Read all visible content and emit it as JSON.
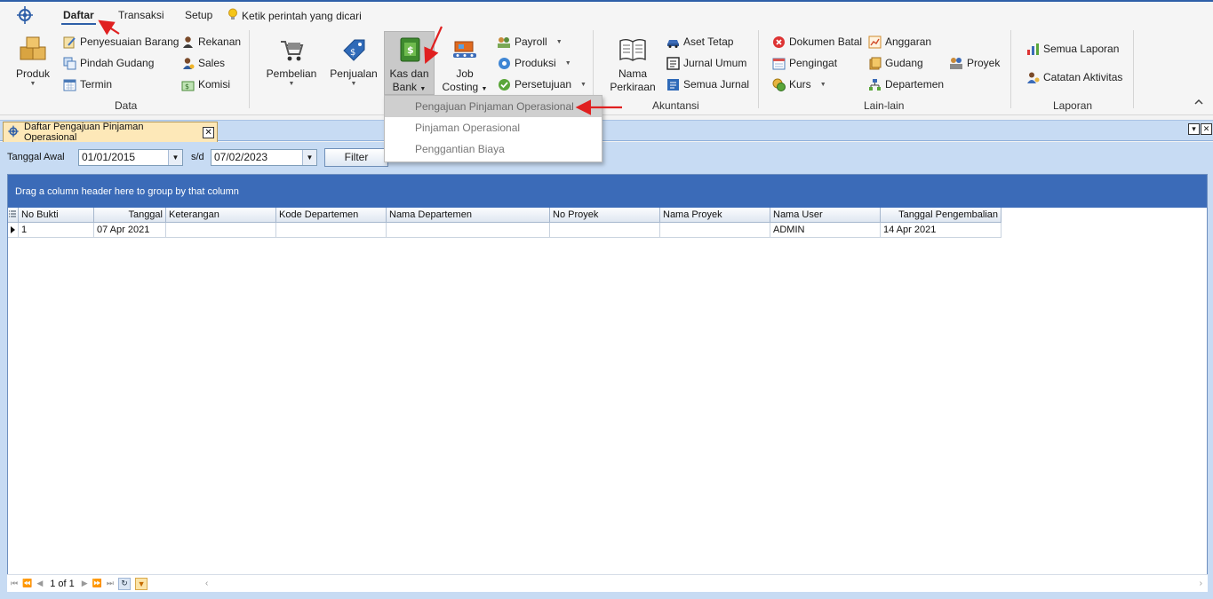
{
  "colors": {
    "accent": "#2e5fa8",
    "ribbon_bg": "#f5f5f5",
    "tabbar_bg": "#c7dbf3",
    "active_doc_tab": "#fde8b8",
    "group_panel": "#3b6bb8",
    "annotation_red": "#e02020"
  },
  "ribbon": {
    "tabs": [
      "Daftar",
      "Transaksi",
      "Setup"
    ],
    "active_tab": "Daftar",
    "search_hint": "Ketik perintah yang dicari",
    "groups": {
      "data": {
        "label": "Data",
        "produk": "Produk",
        "penyesuaian_barang": "Penyesuaian Barang",
        "pindah_gudang": "Pindah Gudang",
        "termin": "Termin",
        "rekanan": "Rekanan",
        "sales": "Sales",
        "komisi": "Komisi"
      },
      "transaksi": {
        "pembelian": "Pembelian",
        "penjualan": "Penjualan",
        "kas_dan_bank_1": "Kas dan",
        "kas_dan_bank_2": "Bank",
        "job_costing_1": "Job",
        "job_costing_2": "Costing",
        "payroll": "Payroll",
        "produksi": "Produksi",
        "persetujuan": "Persetujuan"
      },
      "akuntansi": {
        "label": "Akuntansi",
        "nama_perkiraan_1": "Nama",
        "nama_perkiraan_2": "Perkiraan",
        "aset_tetap": "Aset Tetap",
        "jurnal_umum": "Jurnal Umum",
        "semua_jurnal": "Semua Jurnal"
      },
      "lain_lain": {
        "label": "Lain-lain",
        "dokumen_batal": "Dokumen Batal",
        "pengingat": "Pengingat",
        "kurs": "Kurs",
        "anggaran": "Anggaran",
        "gudang": "Gudang",
        "departemen": "Departemen",
        "proyek": "Proyek"
      },
      "laporan": {
        "label": "Laporan",
        "semua_laporan": "Semua Laporan",
        "catatan_aktivitas": "Catatan Aktivitas"
      }
    }
  },
  "dropdown": {
    "items": [
      "Pengajuan Pinjaman Operasional",
      "Pinjaman Operasional",
      "Penggantian Biaya"
    ],
    "highlighted": "Pengajuan Pinjaman Operasional"
  },
  "document_tab": {
    "title": "Daftar Pengajuan Pinjaman Operasional"
  },
  "filter": {
    "start_label": "Tanggal Awal",
    "start_value": "01/01/2015",
    "sep_label": "s/d",
    "end_value": "07/02/2023",
    "button": "Filter"
  },
  "grid": {
    "group_hint": "Drag a column header here to group by that column",
    "columns": [
      "No Bukti",
      "Tanggal",
      "Keterangan",
      "Kode Departemen",
      "Nama Departemen",
      "No Proyek",
      "Nama Proyek",
      "Nama User",
      "Tanggal Pengembalian"
    ],
    "rows": [
      [
        "1",
        "07 Apr 2021",
        "",
        "",
        "",
        "",
        "",
        "ADMIN",
        "14 Apr 2021"
      ]
    ]
  },
  "pager": {
    "text": "1 of 1"
  }
}
